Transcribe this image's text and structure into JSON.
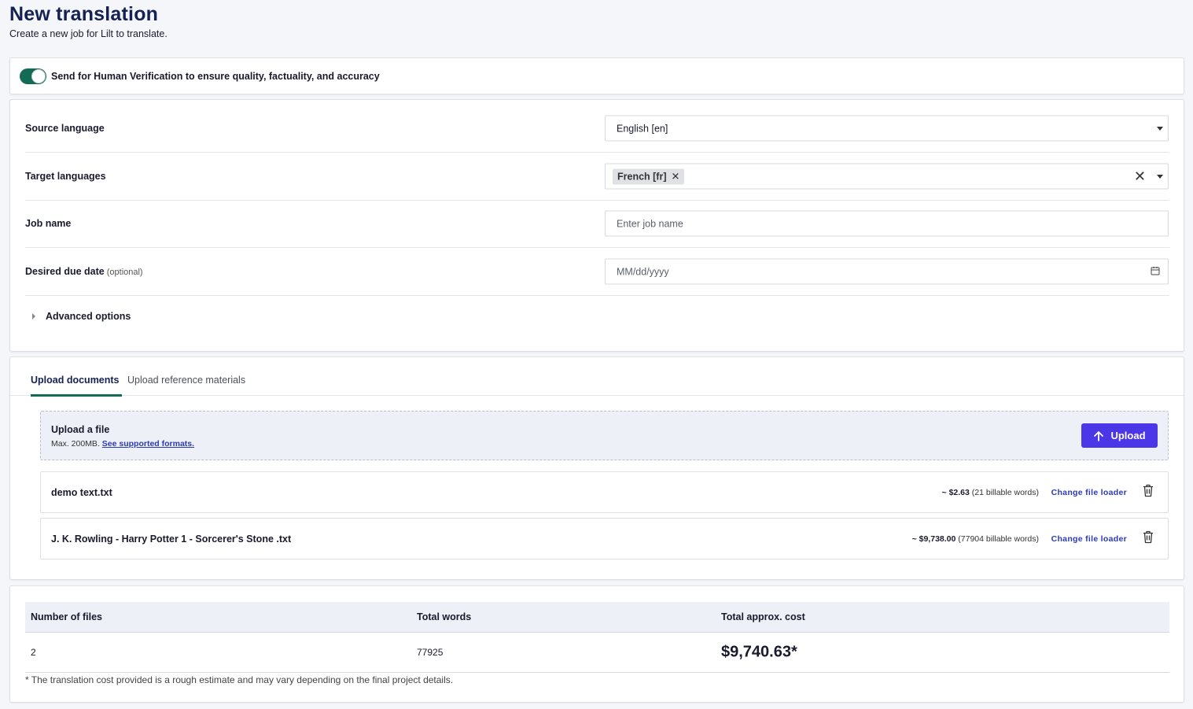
{
  "header": {
    "title": "New translation",
    "subtitle": "Create a new job for Lilt to translate."
  },
  "verification": {
    "enabled": true,
    "label": "Send for Human Verification to ensure quality, factuality, and accuracy"
  },
  "form": {
    "source_label": "Source language",
    "source_value": "English [en]",
    "target_label": "Target languages",
    "target_chips": [
      "French [fr]"
    ],
    "job_label": "Job name",
    "job_placeholder": "Enter job name",
    "due_label": "Desired due date",
    "due_optional": "(optional)",
    "due_placeholder": "MM/dd/yyyy",
    "advanced_label": "Advanced options"
  },
  "upload": {
    "tabs": [
      "Upload documents",
      "Upload reference materials"
    ],
    "dropzone_title": "Upload a file",
    "dropzone_sub": "Max. 200MB.",
    "dropzone_link": "See supported formats.",
    "upload_button": "Upload",
    "change_loader_label": "Change file loader",
    "files": [
      {
        "name": "demo text.txt",
        "cost": "~ $2.63",
        "words": "(21 billable words)"
      },
      {
        "name": "J. K. Rowling - Harry Potter 1 - Sorcerer's Stone .txt",
        "cost": "~ $9,738.00",
        "words": "(77904 billable words)"
      }
    ]
  },
  "summary": {
    "headers": [
      "Number of files",
      "Total words",
      "Total approx. cost"
    ],
    "num_files": "2",
    "total_words": "77925",
    "total_cost": "$9,740.63*",
    "disclaimer": "* The translation cost provided is a rough estimate and may vary depending on the final project details."
  },
  "colors": {
    "accent_green": "#136b56",
    "primary_button": "#4b36e8",
    "link": "#2b3bb5",
    "title": "#142253"
  }
}
